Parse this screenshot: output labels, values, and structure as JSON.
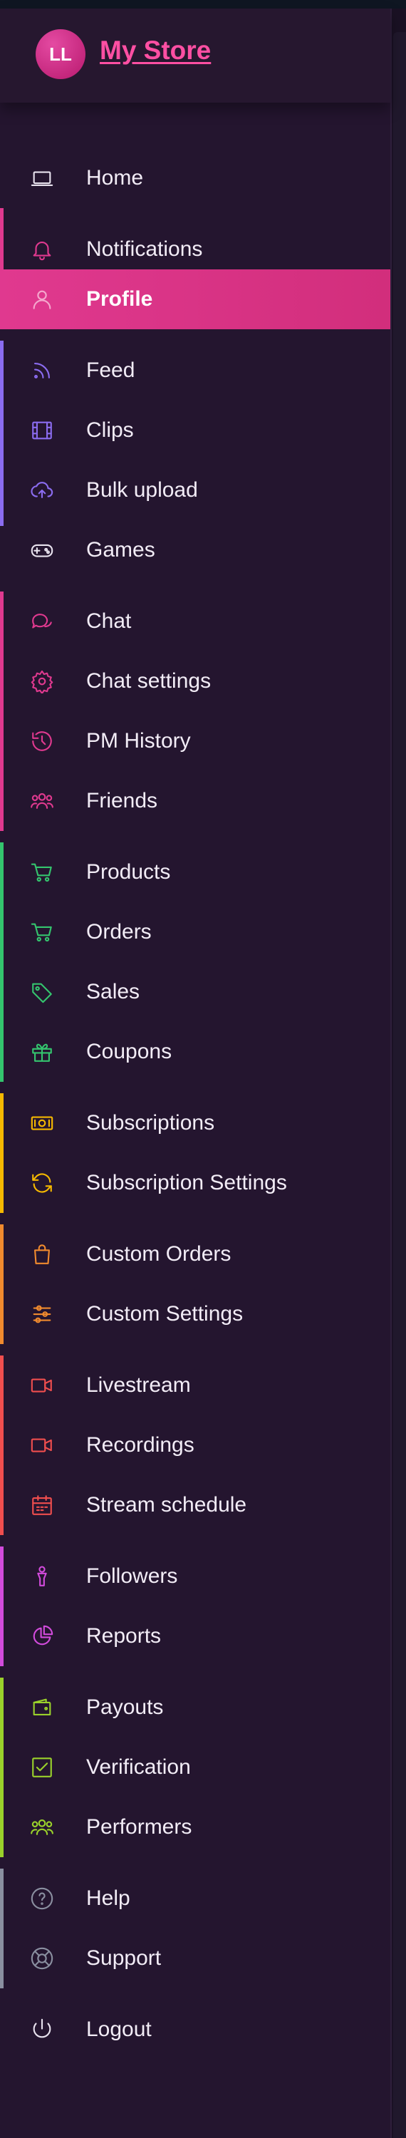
{
  "store": {
    "avatar_initials": "LL",
    "name": "My Store"
  },
  "colors": {
    "background": "#24152f",
    "active": "#e0398f",
    "purple": "#8b6cf0",
    "pink": "#e0398f",
    "green": "#34c46e",
    "yellow": "#f5b800",
    "orange": "#f08a2e",
    "red": "#f04e4e",
    "magenta": "#d24bdc",
    "lime": "#9ad12b",
    "gray": "#8a8fa0"
  },
  "nav": {
    "items": [
      {
        "label": "Home",
        "icon": "home-icon",
        "accent": null
      },
      {
        "label": "Notifications",
        "icon": "bell-icon",
        "accent": "pink"
      },
      {
        "label": "Profile",
        "icon": "user-icon",
        "accent": "pink",
        "active": true
      },
      {
        "label": "Feed",
        "icon": "rss-icon",
        "accent": "purple"
      },
      {
        "label": "Clips",
        "icon": "film-icon",
        "accent": "purple"
      },
      {
        "label": "Bulk upload",
        "icon": "cloud-upload-icon",
        "accent": "purple"
      },
      {
        "label": "Games",
        "icon": "gamepad-icon",
        "accent": null
      },
      {
        "label": "Chat",
        "icon": "chat-bubbles-icon",
        "accent": "pink"
      },
      {
        "label": "Chat settings",
        "icon": "gear-icon",
        "accent": "pink"
      },
      {
        "label": "PM History",
        "icon": "history-icon",
        "accent": "pink"
      },
      {
        "label": "Friends",
        "icon": "users-icon",
        "accent": "pink"
      },
      {
        "label": "Products",
        "icon": "cart-icon",
        "accent": "green"
      },
      {
        "label": "Orders",
        "icon": "cart-icon",
        "accent": "green"
      },
      {
        "label": "Sales",
        "icon": "tag-icon",
        "accent": "green"
      },
      {
        "label": "Coupons",
        "icon": "gift-icon",
        "accent": "green"
      },
      {
        "label": "Subscriptions",
        "icon": "cash-icon",
        "accent": "yellow"
      },
      {
        "label": "Subscription Settings",
        "icon": "refresh-icon",
        "accent": "yellow"
      },
      {
        "label": "Custom Orders",
        "icon": "shopping-bag-icon",
        "accent": "orange"
      },
      {
        "label": "Custom Settings",
        "icon": "sliders-icon",
        "accent": "orange"
      },
      {
        "label": "Livestream",
        "icon": "video-camera-icon",
        "accent": "red"
      },
      {
        "label": "Recordings",
        "icon": "video-camera-icon",
        "accent": "red"
      },
      {
        "label": "Stream schedule",
        "icon": "calendar-icon",
        "accent": "red"
      },
      {
        "label": "Followers",
        "icon": "follower-icon",
        "accent": "magenta"
      },
      {
        "label": "Reports",
        "icon": "pie-chart-icon",
        "accent": "magenta"
      },
      {
        "label": "Payouts",
        "icon": "wallet-icon",
        "accent": "lime"
      },
      {
        "label": "Verification",
        "icon": "checkbox-icon",
        "accent": "lime"
      },
      {
        "label": "Performers",
        "icon": "users-icon",
        "accent": "lime"
      },
      {
        "label": "Help",
        "icon": "help-circle-icon",
        "accent": "gray"
      },
      {
        "label": "Support",
        "icon": "lifebuoy-icon",
        "accent": "gray"
      },
      {
        "label": "Logout",
        "icon": "power-icon",
        "accent": null
      }
    ]
  }
}
